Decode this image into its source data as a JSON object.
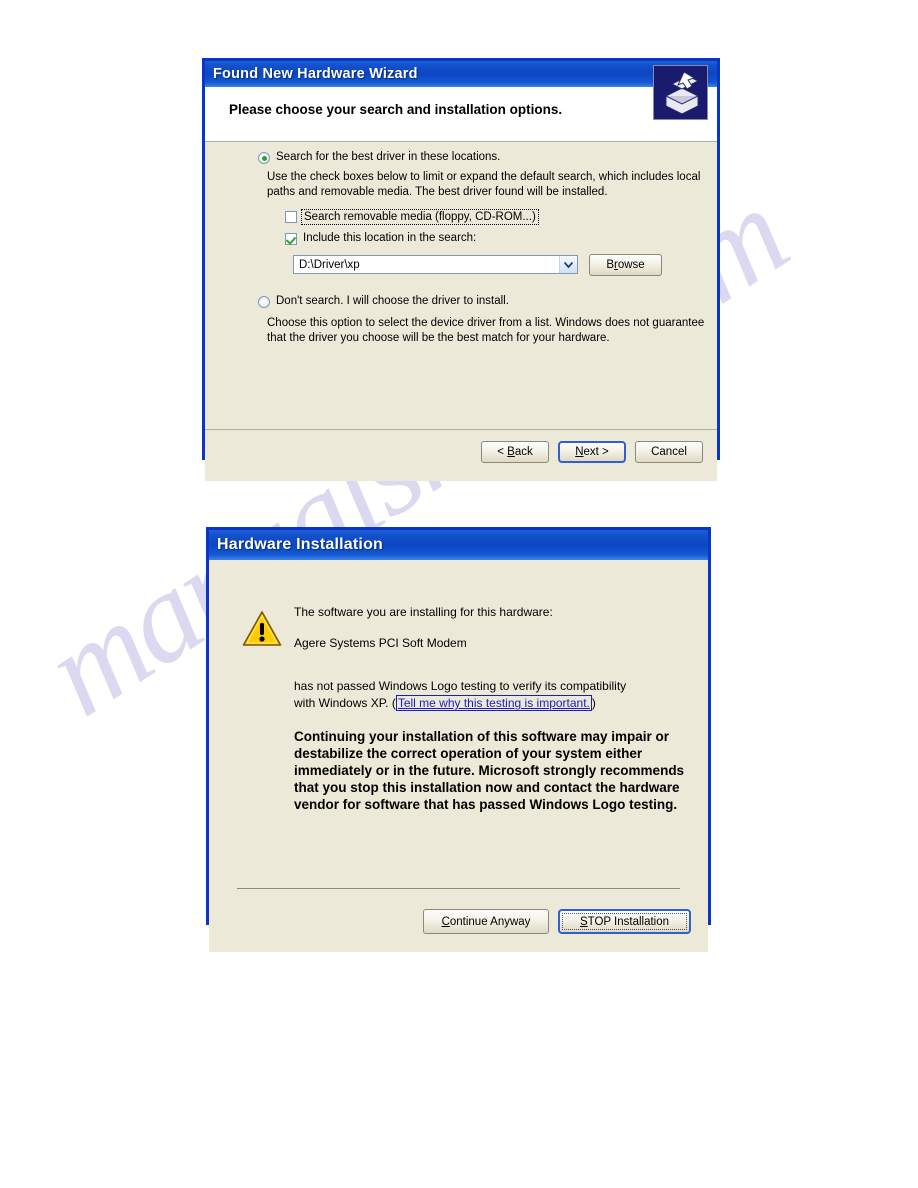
{
  "page": {
    "watermark_text": "manualshive.com",
    "background_color": "#ffffff"
  },
  "colors": {
    "titlebar_blue": "#0b46c4",
    "dialog_border": "#0a35c8",
    "dialog_face": "#ece9d8",
    "accent_green": "#2e9d3e",
    "link_blue": "#1b1bc8",
    "default_button_border": "#2f5fd0",
    "warning_yellow": "#ffcc00"
  },
  "wizard_dialog": {
    "title": "Found New Hardware Wizard",
    "header_title": "Please choose your search and installation options.",
    "header_icon": "wizard-drawer-icon",
    "option_search": {
      "label_prefix": "",
      "label": "Search for the best driver in these locations.",
      "selected": true,
      "description": "Use the check boxes below to limit or expand the default search, which includes local paths and removable media. The best driver found will be installed."
    },
    "checkbox_removable": {
      "label": "Search removable media (floppy, CD-ROM...)",
      "checked": false,
      "focused": true
    },
    "checkbox_include_location": {
      "label": "Include this location in the search:",
      "checked": true
    },
    "location_combo": {
      "value": "D:\\Driver\\xp",
      "placeholder": "D:\\Driver\\xp"
    },
    "browse_button": "Browse",
    "option_dont_search": {
      "label": "Don't search. I will choose the driver to install.",
      "selected": false,
      "description": "Choose this option to select the device driver from a list.  Windows does not guarantee that the driver you choose will be the best match for your hardware."
    },
    "buttons": {
      "back": "< Back",
      "next": "Next >",
      "cancel": "Cancel",
      "default_button": "Next >"
    }
  },
  "hardware_dialog": {
    "title": "Hardware Installation",
    "icon": "warning-triangle-icon",
    "line1": "The software you are installing for this hardware:",
    "device_name": "Agere Systems PCI Soft Modem",
    "line2": "has not passed Windows Logo testing to verify its compatibility",
    "line3_prefix": "with Windows XP. (",
    "link_text": "Tell me why this testing is important.",
    "line3_suffix": ")",
    "warning_paragraph": "Continuing your installation of this software may impair or destabilize the correct operation of your system either immediately or in the future. Microsoft strongly recommends that you stop this installation now and contact the hardware vendor for software that has passed Windows Logo testing.",
    "buttons": {
      "continue": "Continue Anyway",
      "stop": "STOP Installation",
      "default_button": "STOP Installation"
    }
  }
}
